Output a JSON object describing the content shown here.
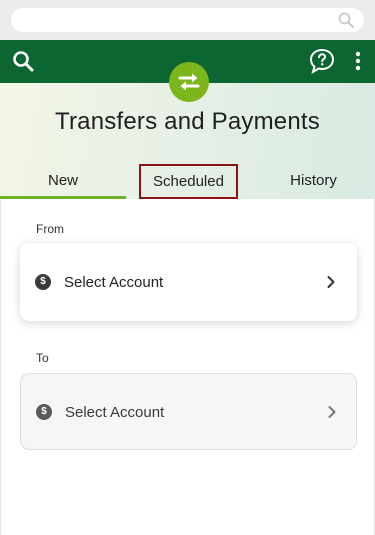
{
  "header": {
    "search_icon": "search-icon",
    "help_icon": "help-chat-icon",
    "more_icon": "more-vertical-icon"
  },
  "hero": {
    "badge_icon": "transfer-arrows-icon",
    "title": "Transfers and Payments"
  },
  "tabs": [
    {
      "label": "New",
      "active": true
    },
    {
      "label": "Scheduled",
      "highlighted": true
    },
    {
      "label": "History"
    }
  ],
  "form": {
    "from_label": "From",
    "to_label": "To",
    "from_account": "Select Account",
    "to_account": "Select Account"
  },
  "colors": {
    "header_green": "#0b6631",
    "accent_lime": "#7cb51c",
    "tab_underline": "#6fb126",
    "highlight_border": "#8b1416"
  }
}
